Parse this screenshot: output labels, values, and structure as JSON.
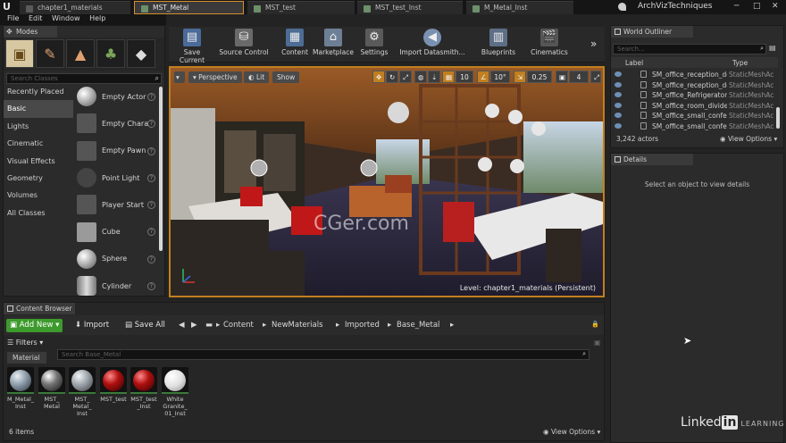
{
  "tabs": [
    {
      "label": "chapter1_materials"
    },
    {
      "label": "MST_Metal"
    },
    {
      "label": "MST_test"
    },
    {
      "label": "MST_test_Inst"
    },
    {
      "label": "M_Metal_Inst"
    }
  ],
  "brand": "ArchVizTechniques",
  "menu": [
    "File",
    "Edit",
    "Window",
    "Help"
  ],
  "modes": {
    "title": "Modes",
    "search_placeholder": "Search Classes",
    "categories": [
      "Recently Placed",
      "Basic",
      "Lights",
      "Cinematic",
      "Visual Effects",
      "Geometry",
      "Volumes",
      "All Classes"
    ],
    "selected_category": "Basic",
    "items": [
      "Empty Actor",
      "Empty Chara",
      "Empty Pawn",
      "Point Light",
      "Player Start",
      "Cube",
      "Sphere",
      "Cylinder"
    ]
  },
  "toolbar": [
    "Save Current",
    "Source Control",
    "Content",
    "Marketplace",
    "Settings",
    "Import Datasmith...",
    "Blueprints",
    "Cinematics"
  ],
  "viewport": {
    "perspective": "Perspective",
    "lit": "Lit",
    "show": "Show",
    "grid_snap": "10",
    "rot_snap": "10°",
    "scale_snap": "0.25",
    "cam_speed": "4",
    "level_label": "Level:",
    "level_name": "chapter1_materials (Persistent)",
    "watermark": "CGer.com"
  },
  "outliner": {
    "title": "World Outliner",
    "search_placeholder": "Search...",
    "col_label": "Label",
    "col_type": "Type",
    "rows": [
      {
        "label": "SM_office_reception_desl",
        "type": "StaticMeshAc"
      },
      {
        "label": "SM_office_reception_desl",
        "type": "StaticMeshAc"
      },
      {
        "label": "SM_office_Refrigerator_m",
        "type": "StaticMeshAc"
      },
      {
        "label": "SM_office_room_divider",
        "type": "StaticMeshAc"
      },
      {
        "label": "SM_office_small_confere",
        "type": "StaticMeshAc"
      },
      {
        "label": "SM_office_small_confere",
        "type": "StaticMeshAc"
      }
    ],
    "actor_count": "3,242 actors",
    "view_options": "View Options"
  },
  "details": {
    "title": "Details",
    "empty_message": "Select an object to view details"
  },
  "content_browser": {
    "title": "Content Browser",
    "add_new": "Add New",
    "import": "Import",
    "save_all": "Save All",
    "breadcrumb": [
      "Content",
      "NewMaterials",
      "Imported",
      "Base_Metal"
    ],
    "filters": "Filters",
    "search_placeholder": "Search Base_Metal",
    "folder_tab": "Material",
    "assets": [
      {
        "name": "M_Metal_ Inst",
        "color": "#8a9aa8"
      },
      {
        "name": "MST_ Metal",
        "color": "#777"
      },
      {
        "name": "MST_ Metal_ Inst",
        "color": "#9aa2a8"
      },
      {
        "name": "MST_test",
        "color": "#b01010"
      },
      {
        "name": "MST_test _Inst",
        "color": "#b01010"
      },
      {
        "name": "White Granite_ 01_Inst",
        "color": "#e8e8e8"
      }
    ],
    "item_count": "6 items",
    "view_options": "View Options"
  },
  "branding": {
    "linked": "Linked",
    "in": "in",
    "learning": "LEARNING"
  }
}
